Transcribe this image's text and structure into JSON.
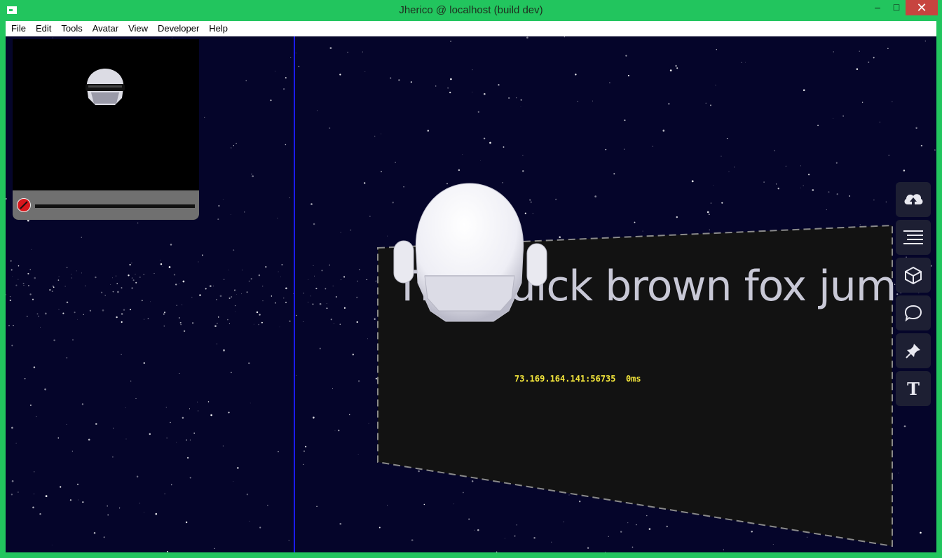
{
  "window": {
    "title": "Jherico @ localhost (build dev)",
    "minimize_glyph": "–",
    "maximize_glyph": "□",
    "close_glyph": "✕"
  },
  "menu": {
    "items": [
      "File",
      "Edit",
      "Tools",
      "Avatar",
      "View",
      "Developer",
      "Help"
    ]
  },
  "mirror": {
    "mute_icon": "mic-muted-icon",
    "mute_color": "#d8171c"
  },
  "scene": {
    "panel_text": "The quick brown fox jum",
    "ip_info": "73.169.164.141:56735  0ms",
    "ip_color": "#f3e53b"
  },
  "toolbar": {
    "buttons": [
      {
        "icon": "cloud-upload-icon"
      },
      {
        "icon": "list-icon"
      },
      {
        "icon": "cube-icon"
      },
      {
        "icon": "chat-bubble-icon"
      },
      {
        "icon": "pin-icon"
      },
      {
        "icon": "text-icon",
        "label": "T"
      }
    ]
  }
}
